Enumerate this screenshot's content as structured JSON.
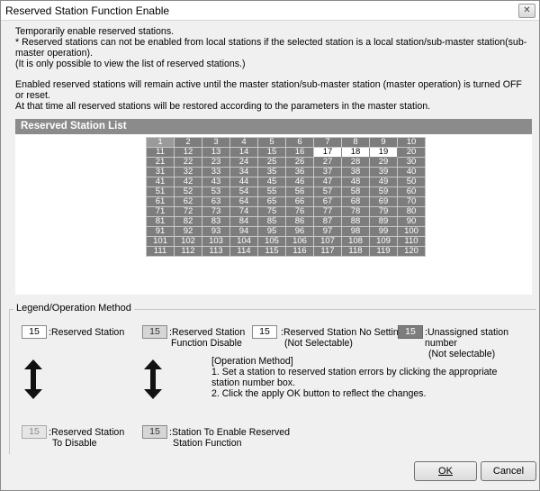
{
  "window": {
    "title": "Reserved Station Function Enable",
    "close_glyph": "✕"
  },
  "description": {
    "line1": "Temporarily enable reserved stations.",
    "line2": "* Reserved stations can not be enabled from local stations if the selected station is a local station/sub-master station(sub-master operation).",
    "line3": "(It is only possible to view the list of reserved stations.)",
    "line4": "Enabled reserved stations will remain active until the master station/sub-master station (master operation) is turned OFF or reset.",
    "line5": "At that time all reserved stations will be restored according to the parameters in the master station."
  },
  "section": {
    "title": "Reserved Station List"
  },
  "station_grid": {
    "rows": [
      [
        "1",
        "2",
        "3",
        "4",
        "5",
        "6",
        "7",
        "8",
        "9",
        "10"
      ],
      [
        "11",
        "12",
        "13",
        "14",
        "15",
        "16",
        "17",
        "18",
        "19",
        "20"
      ],
      [
        "21",
        "22",
        "23",
        "24",
        "25",
        "26",
        "27",
        "28",
        "29",
        "30"
      ],
      [
        "31",
        "32",
        "33",
        "34",
        "35",
        "36",
        "37",
        "38",
        "39",
        "40"
      ],
      [
        "41",
        "42",
        "43",
        "44",
        "45",
        "46",
        "47",
        "48",
        "49",
        "50"
      ],
      [
        "51",
        "52",
        "53",
        "54",
        "55",
        "56",
        "57",
        "58",
        "59",
        "60"
      ],
      [
        "61",
        "62",
        "63",
        "64",
        "65",
        "66",
        "67",
        "68",
        "69",
        "70"
      ],
      [
        "71",
        "72",
        "73",
        "74",
        "75",
        "76",
        "77",
        "78",
        "79",
        "80"
      ],
      [
        "81",
        "82",
        "83",
        "84",
        "85",
        "86",
        "87",
        "88",
        "89",
        "90"
      ],
      [
        "91",
        "92",
        "93",
        "94",
        "95",
        "96",
        "97",
        "98",
        "99",
        "100"
      ],
      [
        "101",
        "102",
        "103",
        "104",
        "105",
        "106",
        "107",
        "108",
        "109",
        "110"
      ],
      [
        "111",
        "112",
        "113",
        "114",
        "115",
        "116",
        "117",
        "118",
        "119",
        "120"
      ]
    ],
    "highlighted": [
      "17",
      "18",
      "19"
    ],
    "colors": {
      "cell": "#7d7d7d",
      "highlight": "#ffffff",
      "first": "#9a9a9a"
    }
  },
  "legend": {
    "title": "Legend/Operation Method",
    "sample_number": "15",
    "reserved_station": ":Reserved Station",
    "reserved_function_disable_1": ":Reserved Station",
    "reserved_function_disable_2": "Function Disable",
    "no_setting_1": ":Reserved Station No Setting",
    "no_setting_2": "(Not Selectable)",
    "unassigned_1": ":Unassigned station number",
    "unassigned_2": "(Not selectable)",
    "to_disable_1": ":Reserved Station",
    "to_disable_2": "To Disable",
    "to_enable_1": ":Station To Enable Reserved",
    "to_enable_2": "Station Function"
  },
  "operation_method": {
    "title": "[Operation Method]",
    "step1": "1. Set a station to reserved station errors by clicking the appropriate station number box.",
    "step2": "2. Click the apply OK button to reflect the changes."
  },
  "buttons": {
    "ok": "OK",
    "cancel": "Cancel"
  }
}
